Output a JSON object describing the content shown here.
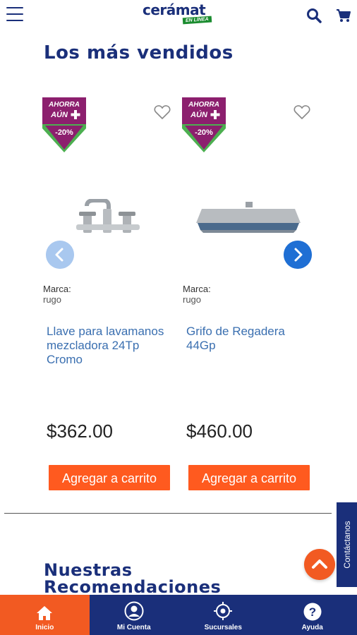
{
  "header": {
    "logo_text": "cerámat",
    "logo_tagline": "EN LÍNEA",
    "menu_icon": "hamburger-menu-icon",
    "search_icon": "search-icon",
    "cart_icon": "shopping-cart-icon"
  },
  "best_sellers": {
    "title": "Los más vendidos",
    "products": [
      {
        "badge_line1": "AHORRA",
        "badge_line2": "AÚN",
        "badge_discount": "-20%",
        "brand_label": "Marca:",
        "brand": "rugo",
        "name": "Llave para lavamanos mezcladora 24Tp Cromo",
        "price": "$362.00",
        "add_label": "Agregar a carrito"
      },
      {
        "badge_line1": "AHORRA",
        "badge_line2": "AÚN",
        "badge_discount": "-20%",
        "brand_label": "Marca:",
        "brand": "rugo",
        "name": "Grifo de Regadera 44Gp",
        "price": "$460.00",
        "add_label": "Agregar a carrito"
      }
    ]
  },
  "recommendations": {
    "title_line1": "Nuestras",
    "title_line2": "Recomendaciones"
  },
  "contact_tab": {
    "label": "Contáctanos"
  },
  "bottom_nav": [
    {
      "label": "Inicio",
      "icon": "home-icon",
      "active": true
    },
    {
      "label": "Mi Cuenta",
      "icon": "user-icon",
      "active": false
    },
    {
      "label": "Sucursales",
      "icon": "location-target-icon",
      "active": false
    },
    {
      "label": "Ayuda",
      "icon": "help-icon",
      "active": false
    }
  ],
  "colors": {
    "brand_blue": "#1a2f7a",
    "accent_orange": "#f25a22",
    "button_orange": "#ff5a1f",
    "link_blue": "#3a6fb0",
    "badge_purple": "#8c1f6e",
    "badge_green": "#4caf50"
  }
}
